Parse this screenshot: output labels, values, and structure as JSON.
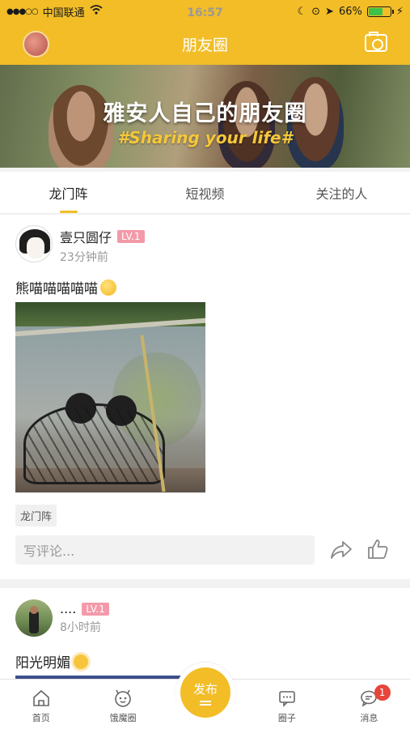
{
  "status_bar": {
    "carrier": "中国联通",
    "time": "16:57",
    "battery": "66%",
    "battery_level": 0.66
  },
  "navbar": {
    "title": "朋友圈"
  },
  "banner": {
    "headline": "雅安人自己的朋友圈",
    "subline": "#Sharing your life#"
  },
  "tabs": [
    {
      "label": "龙门阵",
      "active": true
    },
    {
      "label": "短视频",
      "active": false
    },
    {
      "label": "关注的人",
      "active": false
    }
  ],
  "posts": [
    {
      "user": "壹只圆仔",
      "level": "LV.1",
      "time": "23分钟前",
      "text": "熊喵喵喵喵喵",
      "tag": "龙门阵",
      "comment_placeholder": "写评论..."
    },
    {
      "user": "....",
      "level": "LV.1",
      "time": "8小时前",
      "text": "阳光明媚"
    }
  ],
  "tabbar": {
    "items": [
      {
        "label": "首页",
        "icon": "home-icon"
      },
      {
        "label": "饿魔圈",
        "icon": "face-icon"
      },
      {
        "label": "圈子",
        "icon": "chat-icon"
      },
      {
        "label": "消息",
        "icon": "message-icon",
        "badge": "1"
      }
    ],
    "publish_label": "发布"
  },
  "colors": {
    "accent": "#f2bd27",
    "level_badge": "#f39aaa",
    "notification": "#e7443a"
  }
}
